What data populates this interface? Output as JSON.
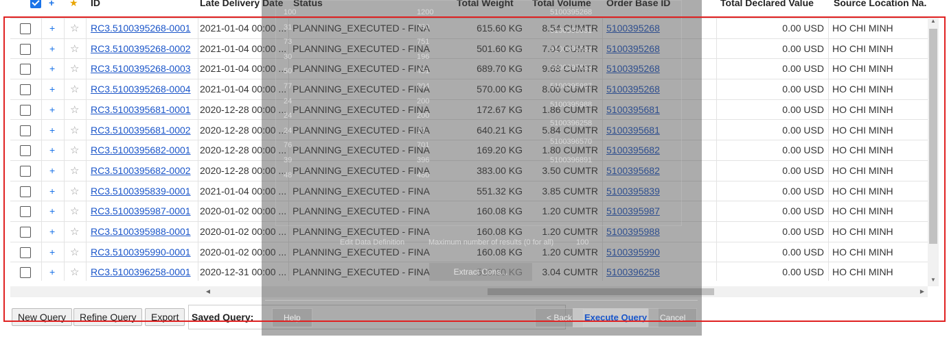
{
  "header": {
    "id": "ID",
    "late_delivery_date": "Late Delivery Date",
    "status": "Status",
    "total_weight": "Total Weight",
    "total_volume": "Total Volume",
    "order_base_id": "Order Base ID",
    "total_declared_value": "Total Declared Value",
    "source_location": "Source Location Na."
  },
  "rows": [
    {
      "id": "RC3.5100395268-0001",
      "date": "2021-01-04 00:00 ...",
      "status": "PLANNING_EXECUTED - FINAL",
      "weight": "615.60 KG",
      "volume": "8.54 CUMTR",
      "order": "5100395268",
      "declared": "0.00 USD",
      "source": "HO CHI MINH"
    },
    {
      "id": "RC3.5100395268-0002",
      "date": "2021-01-04 00:00 ...",
      "status": "PLANNING_EXECUTED - FINAL",
      "weight": "501.60 KG",
      "volume": "7.04 CUMTR",
      "order": "5100395268",
      "declared": "0.00 USD",
      "source": "HO CHI MINH"
    },
    {
      "id": "RC3.5100395268-0003",
      "date": "2021-01-04 00:00 ...",
      "status": "PLANNING_EXECUTED - FINAL",
      "weight": "689.70 KG",
      "volume": "9.68 CUMTR",
      "order": "5100395268",
      "declared": "0.00 USD",
      "source": "HO CHI MINH"
    },
    {
      "id": "RC3.5100395268-0004",
      "date": "2021-01-04 00:00 ...",
      "status": "PLANNING_EXECUTED - FINAL",
      "weight": "570.00 KG",
      "volume": "8.00 CUMTR",
      "order": "5100395268",
      "declared": "0.00 USD",
      "source": "HO CHI MINH"
    },
    {
      "id": "RC3.5100395681-0001",
      "date": "2020-12-28 00:00 ...",
      "status": "PLANNING_EXECUTED - FINAL",
      "weight": "172.67 KG",
      "volume": "1.86 CUMTR",
      "order": "5100395681",
      "declared": "0.00 USD",
      "source": "HO CHI MINH"
    },
    {
      "id": "RC3.5100395681-0002",
      "date": "2020-12-28 00:00 ...",
      "status": "PLANNING_EXECUTED - FINAL",
      "weight": "640.21 KG",
      "volume": "5.84 CUMTR",
      "order": "5100395681",
      "declared": "0.00 USD",
      "source": "HO CHI MINH"
    },
    {
      "id": "RC3.5100395682-0001",
      "date": "2020-12-28 00:00 ...",
      "status": "PLANNING_EXECUTED - FINAL",
      "weight": "169.20 KG",
      "volume": "1.80 CUMTR",
      "order": "5100395682",
      "declared": "0.00 USD",
      "source": "HO CHI MINH"
    },
    {
      "id": "RC3.5100395682-0002",
      "date": "2020-12-28 00:00 ...",
      "status": "PLANNING_EXECUTED - FINAL",
      "weight": "383.00 KG",
      "volume": "3.50 CUMTR",
      "order": "5100395682",
      "declared": "0.00 USD",
      "source": "HO CHI MINH"
    },
    {
      "id": "RC3.5100395839-0001",
      "date": "2021-01-04 00:00 ...",
      "status": "PLANNING_EXECUTED - FINAL",
      "weight": "551.32 KG",
      "volume": "3.85 CUMTR",
      "order": "5100395839",
      "declared": "0.00 USD",
      "source": "HO CHI MINH"
    },
    {
      "id": "RC3.5100395987-0001",
      "date": "2020-01-02 00:00 ...",
      "status": "PLANNING_EXECUTED - FINAL",
      "weight": "160.08 KG",
      "volume": "1.20 CUMTR",
      "order": "5100395987",
      "declared": "0.00 USD",
      "source": "HO CHI MINH"
    },
    {
      "id": "RC3.5100395988-0001",
      "date": "2020-01-02 00:00 ...",
      "status": "PLANNING_EXECUTED - FINAL",
      "weight": "160.08 KG",
      "volume": "1.20 CUMTR",
      "order": "5100395988",
      "declared": "0.00 USD",
      "source": "HO CHI MINH"
    },
    {
      "id": "RC3.5100395990-0001",
      "date": "2020-01-02 00:00 ...",
      "status": "PLANNING_EXECUTED - FINAL",
      "weight": "160.08 KG",
      "volume": "1.20 CUMTR",
      "order": "5100395990",
      "declared": "0.00 USD",
      "source": "HO CHI MINH"
    },
    {
      "id": "RC3.5100396258-0001",
      "date": "2020-12-31 00:00 ...",
      "status": "PLANNING_EXECUTED - FINAL",
      "weight": "516.80 KG",
      "volume": "3.04 CUMTR",
      "order": "5100396258",
      "declared": "0.00 USD",
      "source": "HO CHI MINH"
    }
  ],
  "icons": {
    "plus": "+",
    "star": "☆",
    "star_header": "★"
  },
  "buttons": {
    "new_query": "New Query",
    "refine_query": "Refine Query",
    "export": "Export",
    "saved_query": "Saved Query:"
  },
  "dialog": {
    "edit_data_definition": "Edit Data Definition",
    "max_results_label": "Maximum number of results (0 for all)",
    "max_results_value": "100",
    "extract_label": "Extract Cons...",
    "help": "Help",
    "back": "< Back",
    "execute_query": "Execute Query",
    "cancel": "Cancel",
    "ghost_numbers_left": [
      "100",
      "31",
      "73",
      "30",
      "50",
      "77",
      "24",
      "24",
      "24",
      "76",
      "39",
      "48"
    ],
    "ghost_numbers_mid": [
      "1200",
      "750",
      "751",
      "196",
      "451",
      "204",
      "200",
      "200",
      "10",
      "701",
      "396",
      "480"
    ],
    "ghost_ids": [
      "5100395268",
      "5100395681",
      "5100395682",
      "5100395683",
      "5100395987",
      "5100395988",
      "5100396258",
      "5100396570",
      "5100396891"
    ]
  },
  "colors": {
    "accent": "#1a73e8",
    "link": "#1a55c9",
    "frame": "#e02020"
  }
}
